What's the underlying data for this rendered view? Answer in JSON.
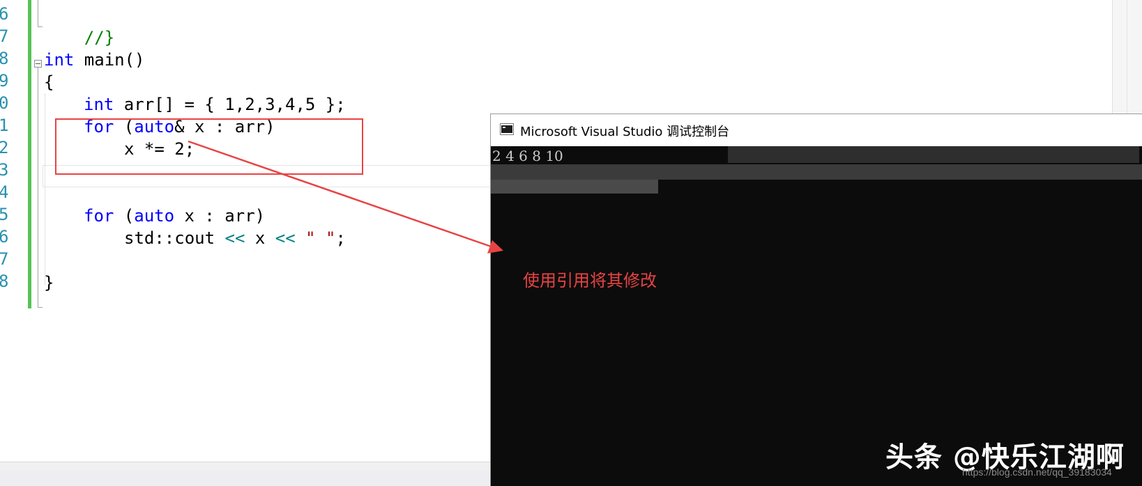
{
  "editor": {
    "line_numbers": [
      "6",
      "7",
      "8",
      "9",
      "0",
      "1",
      "2",
      "3",
      "4",
      "5",
      "6",
      "7",
      "8"
    ],
    "code": {
      "l6_comment": "//}",
      "l8_kw": "int",
      "l8_rest": " main()",
      "l9": "{",
      "l10_kw": "int",
      "l10_rest": " arr[] = { 1,2,3,4,5 };",
      "l11_for": "for",
      "l11_paren": " (",
      "l11_auto": "auto",
      "l11_rest": "& x : arr)",
      "l12": "x *= 2;",
      "l15_for": "for",
      "l15_paren": " (",
      "l15_auto": "auto",
      "l15_rest": " x : arr)",
      "l16_a": "std::cout ",
      "l16_op1": "<<",
      "l16_x": " x ",
      "l16_op2": "<<",
      "l16_sp": " ",
      "l16_str": "\" \"",
      "l16_end": ";",
      "l18": "}"
    }
  },
  "console": {
    "title": "Microsoft Visual Studio 调试控制台",
    "output": "2 4 6 8 10"
  },
  "annotation": {
    "text": "使用引用将其修改",
    "color": "#e84343"
  },
  "watermark": {
    "text": "头条 @快乐江湖啊",
    "url": "https://blog.csdn.net/qq_39183034"
  },
  "colors": {
    "keyword": "#0000ff",
    "comment": "#008000",
    "operator": "#008080",
    "string": "#a31515",
    "line_number": "#2b91af",
    "change_bar": "#57c257"
  }
}
